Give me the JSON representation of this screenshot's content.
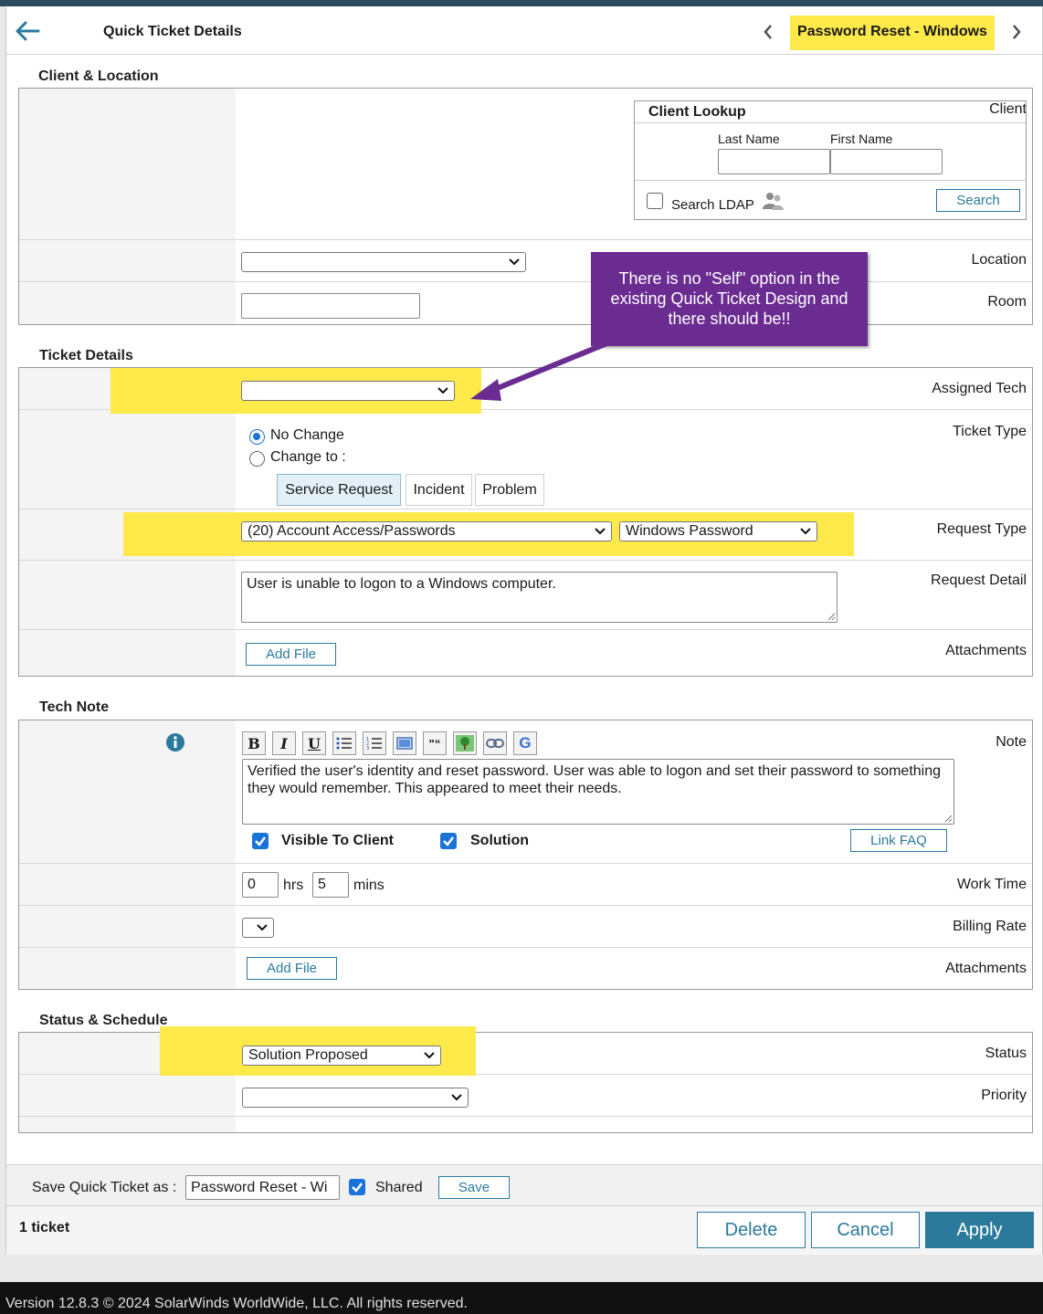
{
  "header": {
    "title": "Quick Ticket Details",
    "ticket_name": "Password Reset - Windows"
  },
  "client_location": {
    "section_title": "Client & Location",
    "client_label": "Client",
    "lookup_title": "Client Lookup",
    "last_name_label": "Last Name",
    "first_name_label": "First Name",
    "last_name_value": "",
    "first_name_value": "",
    "search_ldap_label": "Search LDAP",
    "search_button": "Search",
    "location_label": "Location",
    "location_value": "",
    "room_label": "Room",
    "room_value": ""
  },
  "callout": {
    "text": "There is no \"Self\" option in the existing Quick Ticket Design and there should be!!"
  },
  "ticket_details": {
    "section_title": "Ticket Details",
    "assigned_tech_label": "Assigned Tech",
    "assigned_tech_value": "",
    "ticket_type_label": "Ticket Type",
    "no_change_label": "No Change",
    "change_to_label": "Change to :",
    "type_buttons": [
      "Service Request",
      "Incident",
      "Problem"
    ],
    "request_type_label": "Request Type",
    "request_type_value": "(20) Account Access/Passwords",
    "request_subtype_value": "Windows Password",
    "request_detail_label": "Request Detail",
    "request_detail_value": "User is unable to logon to a Windows computer.",
    "attachments_label": "Attachments",
    "add_file_button": "Add File"
  },
  "tech_note": {
    "section_title": "Tech Note",
    "note_label": "Note",
    "note_value": "Verified the user's identity and reset password.  User was able to logon and set their password to something they would remember.  This appeared to meet their needs.",
    "visible_to_client_label": "Visible To Client",
    "solution_label": "Solution",
    "link_faq_button": "Link FAQ",
    "work_time_label": "Work Time",
    "hours_value": "0",
    "hrs_label": "hrs",
    "minutes_value": "5",
    "mins_label": "mins",
    "billing_rate_label": "Billing Rate",
    "attachments_label": "Attachments",
    "add_file_button": "Add File"
  },
  "status_schedule": {
    "section_title": "Status & Schedule",
    "status_label": "Status",
    "status_value": "Solution Proposed",
    "priority_label": "Priority",
    "priority_value": ""
  },
  "save_bar": {
    "label": "Save Quick Ticket as :",
    "name_value": "Password Reset - Wi",
    "shared_label": "Shared",
    "save_button": "Save"
  },
  "bottom_bar": {
    "count": "1 ticket",
    "delete_button": "Delete",
    "cancel_button": "Cancel",
    "apply_button": "Apply"
  },
  "footer": {
    "text": "Version 12.8.3 © 2024 SolarWinds WorldWide, LLC. All rights reserved."
  },
  "colors": {
    "highlight": "#fde94a",
    "accent": "#2b7a9c",
    "callout": "#6a2c91",
    "checkbox": "#1a73d9"
  },
  "icons": [
    "back-arrow-icon",
    "chevron-left-icon",
    "chevron-right-icon",
    "users-icon",
    "info-icon",
    "bold-icon",
    "italic-icon",
    "underline-icon",
    "bullet-list-icon",
    "numbered-list-icon",
    "image-icon",
    "quote-icon",
    "tree-image-icon",
    "link-icon",
    "google-icon"
  ]
}
